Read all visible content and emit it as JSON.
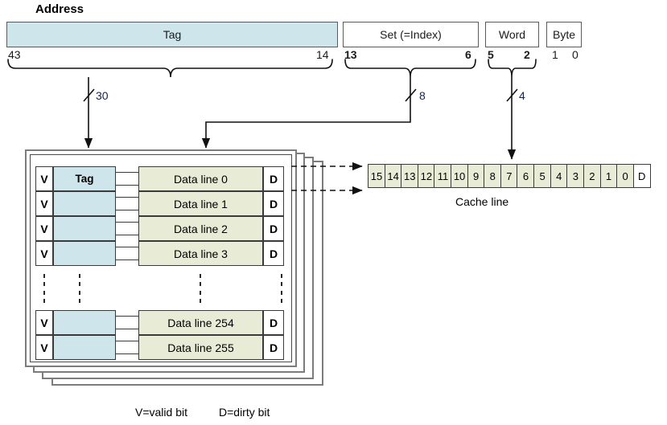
{
  "title": "Address",
  "colors": {
    "tag_fill": "#cfe5ec",
    "data_fill": "#e8ecd7",
    "border": "#3a3a3a",
    "frame": "#7c7c7c",
    "width_label": "#17224a"
  },
  "address": {
    "label": "Address",
    "fields": [
      {
        "name": "tag",
        "label": "Tag",
        "hi": "43",
        "lo": "14",
        "bold_bits": false,
        "width_label": "30"
      },
      {
        "name": "set",
        "label": "Set (=Index)",
        "hi": "13",
        "lo": "6",
        "bold_bits": true,
        "width_label": "8"
      },
      {
        "name": "word",
        "label": "Word",
        "hi": "5",
        "lo": "2",
        "bold_bits": true,
        "width_label": "4"
      },
      {
        "name": "byte",
        "label": "Byte",
        "hi": "1",
        "lo": "0",
        "bold_bits": false,
        "width_label": ""
      }
    ]
  },
  "cache": {
    "valid_label": "V",
    "dirty_label": "D",
    "tag_header": "Tag",
    "rows": [
      {
        "data": "Data line 0"
      },
      {
        "data": "Data line 1"
      },
      {
        "data": "Data line 2"
      },
      {
        "data": "Data line 3"
      }
    ],
    "rows_bottom": [
      {
        "data": "Data line 254"
      },
      {
        "data": "Data line 255"
      }
    ],
    "ellipsis": true,
    "ways": 4
  },
  "cache_line": {
    "caption": "Cache line",
    "words": [
      "15",
      "14",
      "13",
      "12",
      "11",
      "10",
      "9",
      "8",
      "7",
      "6",
      "5",
      "4",
      "3",
      "2",
      "1",
      "0"
    ],
    "dirty_label": "D"
  },
  "legend": {
    "valid": "V=valid bit",
    "dirty": "D=dirty bit"
  }
}
